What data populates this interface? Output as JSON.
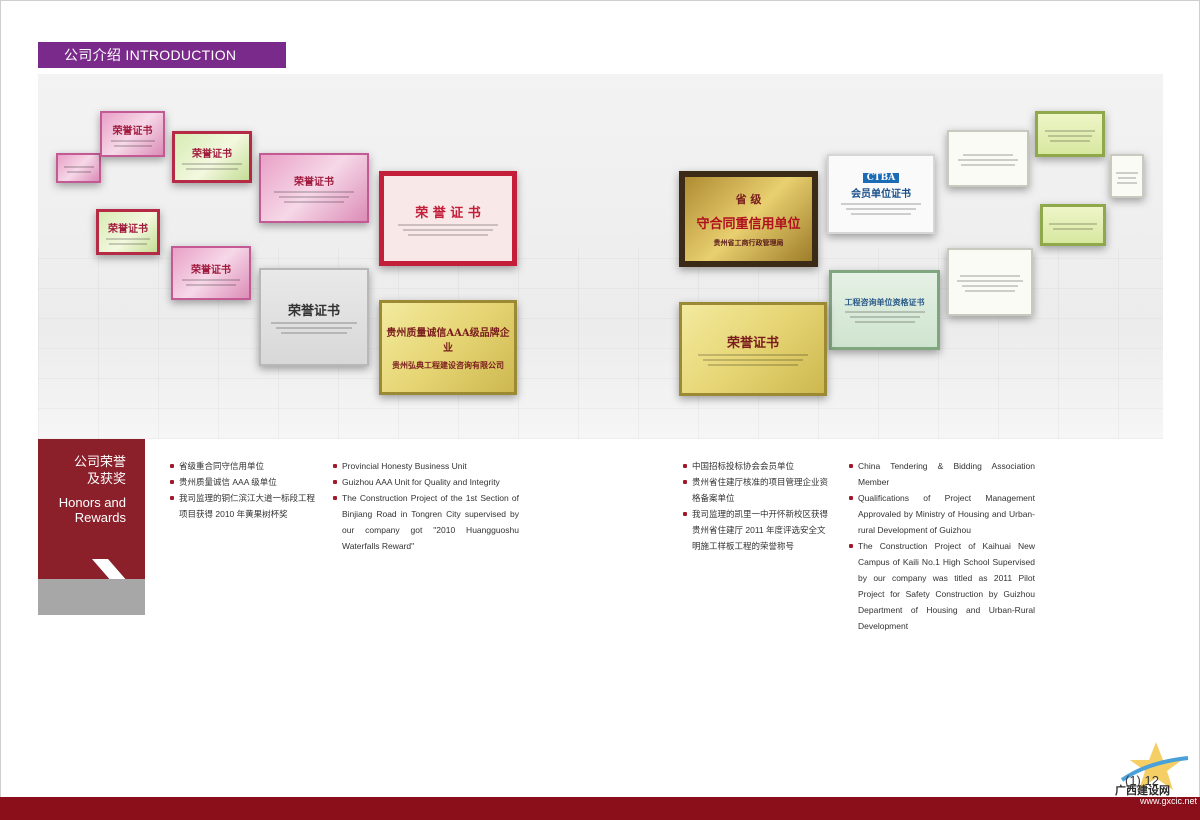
{
  "header": {
    "tab_label": "公司介绍  INTRODUCTION"
  },
  "gallery": {
    "certs": {
      "rongyu": "荣誉证书",
      "rongyu_spaced": "荣 誉 证 书",
      "rongyu_small": "荣誉证书",
      "aaa": "贵州质量诚信AAA级品牌企业",
      "aaa_company": "贵州弘典工程建设咨询有限公司",
      "credit_top": "省    级",
      "credit_main": "守合同重信用单位",
      "credit_org": "贵州省工商行政管理局",
      "ctba_logo": "CTBA",
      "ctba_title": "会员单位证书",
      "qual_title": "工程咨询单位资格证书"
    }
  },
  "honors": {
    "title_cn": "公司荣誉及获奖",
    "title_en": "Honors and Rewards",
    "left_cn": [
      "省级重合同守信用单位",
      "贵州质量诚信 AAA 级单位",
      "我司监理的铜仁滨江大道一标段工程项目获得 2010 年黄果树杯奖"
    ],
    "left_en": [
      "Provincial Honesty Business Unit",
      "Guizhou AAA Unit for Quality and Integrity",
      "The Construction Project of the 1st Section of Binjiang Road in Tongren City supervised by our company got \"2010 Huangguoshu Waterfalls Reward\""
    ],
    "right_cn": [
      "中国招标投标协会会员单位",
      "贵州省住建厅核准的项目管理企业资格备案单位",
      "我司监理的凯里一中开怀新校区获得贵州省住建厅 2011 年度评选安全文明施工样板工程的荣誉称号"
    ],
    "right_en": [
      "China Tendering & Bidding Association Member",
      "Qualifications of Project Management Approvaled by Ministry of Housing and Urban-rural Development of Guizhou",
      "The Construction Project of Kaihuai New Campus of Kaili No.1 High School Supervised by our company was titled as 2011 Pilot Project for Safety Construction by Guizhou Department of Housing and Urban-Rural Development"
    ]
  },
  "footer": {
    "page_number": "(1) 12",
    "logo_text": "广西建设网",
    "logo_url": "www.gxcic.net"
  },
  "colors": {
    "accent_purple": "#7a2a8a",
    "accent_red": "#8b1f2a",
    "footer_red": "#8b0f1b"
  }
}
